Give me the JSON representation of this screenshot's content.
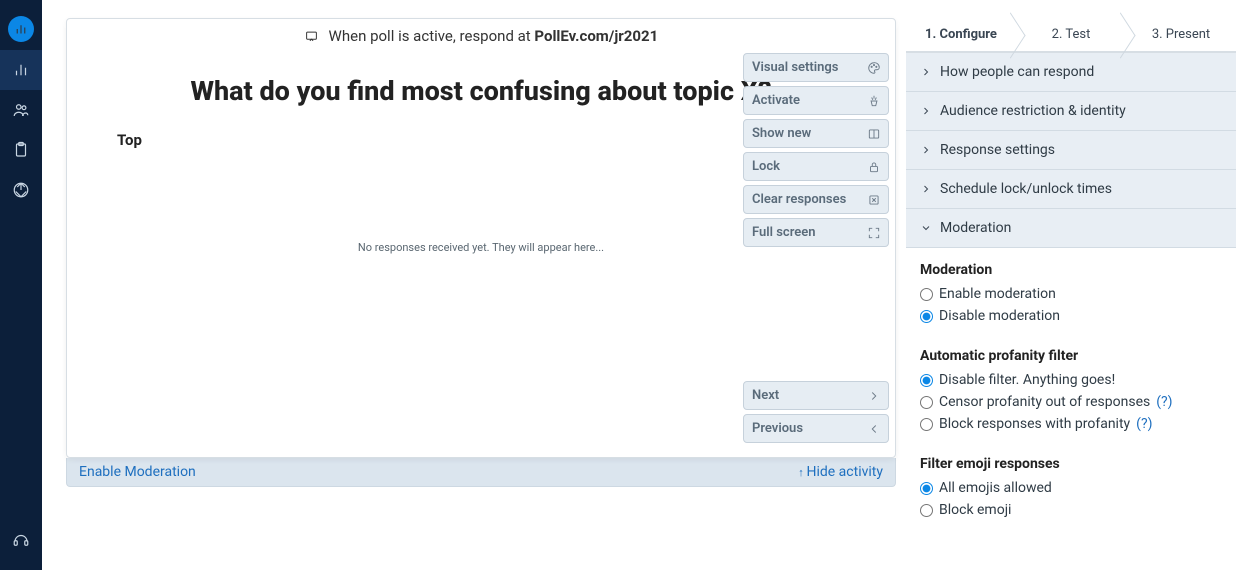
{
  "rail": {
    "items": [
      "logo",
      "activities",
      "participants",
      "surveys",
      "reports",
      "support"
    ]
  },
  "stage": {
    "respond_prefix": "When poll is active, respond at ",
    "respond_url": "PollEv.com/jr2021",
    "question": "What do you find most confusing about topic X?",
    "top_label": "Top",
    "empty_text": "No responses received yet. They will appear here...",
    "controls": {
      "visual": "Visual settings",
      "activate": "Activate",
      "show_new": "Show new",
      "lock": "Lock",
      "clear": "Clear responses",
      "fullscreen": "Full screen",
      "next": "Next",
      "previous": "Previous"
    },
    "footer": {
      "enable_moderation": "Enable Moderation",
      "hide_activity": "Hide activity"
    }
  },
  "sidebar": {
    "steps": [
      "1. Configure",
      "2. Test",
      "3. Present"
    ],
    "accordion": {
      "how_respond": "How people can respond",
      "audience": "Audience restriction & identity",
      "response_settings": "Response settings",
      "schedule": "Schedule lock/unlock times",
      "moderation": "Moderation"
    },
    "moderation": {
      "heading": "Moderation",
      "enable": "Enable moderation",
      "disable": "Disable moderation",
      "selected": "disable"
    },
    "profanity": {
      "heading": "Automatic profanity filter",
      "disable": "Disable filter. Anything goes!",
      "censor": "Censor profanity out of responses",
      "block": "Block responses with profanity",
      "help": "(?)",
      "selected": "disable"
    },
    "emoji": {
      "heading": "Filter emoji responses",
      "allow": "All emojis allowed",
      "block": "Block emoji",
      "selected": "allow"
    }
  }
}
